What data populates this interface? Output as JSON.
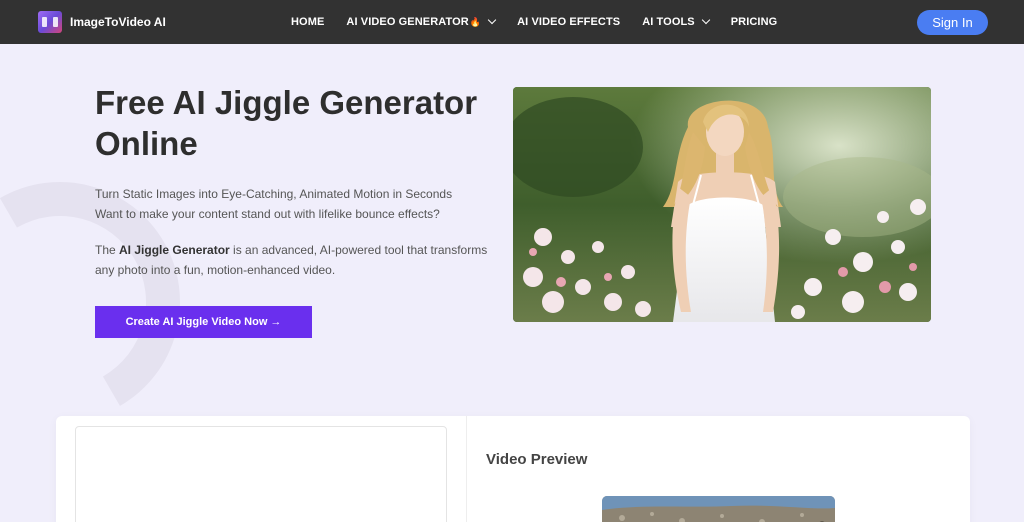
{
  "brand": {
    "name": "ImageToVideo AI"
  },
  "nav": {
    "items": [
      {
        "label": "HOME",
        "dropdown": false
      },
      {
        "label": "AI VIDEO GENERATOR",
        "badge": "🔥",
        "dropdown": true
      },
      {
        "label": "AI VIDEO EFFECTS",
        "dropdown": false
      },
      {
        "label": "AI TOOLS",
        "dropdown": true
      },
      {
        "label": "PRICING",
        "dropdown": false
      }
    ],
    "sign_in": "Sign In"
  },
  "hero": {
    "title": "Free AI Jiggle Generator Online",
    "line1": "Turn Static Images into Eye-Catching, Animated Motion in Seconds",
    "line2": "Want to make your content stand out with lifelike bounce effects?",
    "p2_prefix": "The ",
    "p2_bold": "AI Jiggle Generator",
    "p2_rest": " is an advanced, AI-powered tool that transforms any photo into a fun, motion-enhanced video.",
    "cta": "Create AI Jiggle Video Now →"
  },
  "preview": {
    "title": "Video Preview"
  },
  "colors": {
    "nav_bg": "#323232",
    "page_bg": "#f0eefb",
    "cta_bg": "#6a2fee",
    "signin_bg": "#4a7df2"
  }
}
